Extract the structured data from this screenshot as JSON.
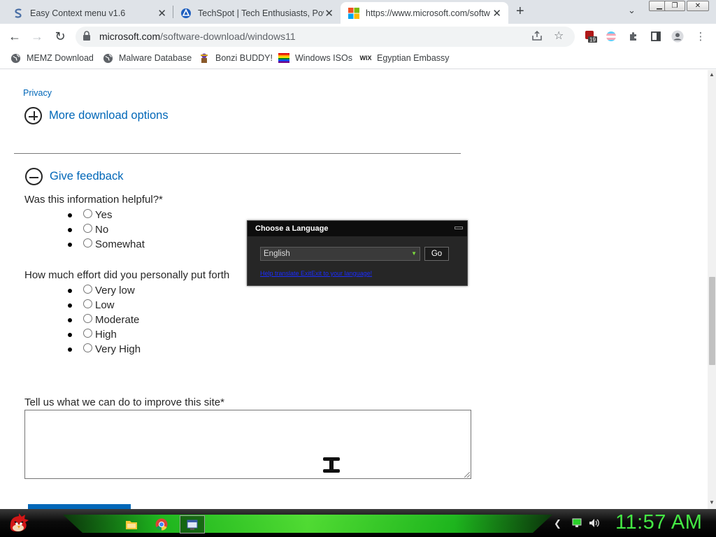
{
  "browser": {
    "tabs": [
      {
        "title": "Easy Context menu v1.6",
        "icon": "s-letter-icon"
      },
      {
        "title": "TechSpot | Tech Enthusiasts, Pow",
        "icon": "techspot-icon"
      },
      {
        "title": "https://www.microsoft.com/softw",
        "icon": "microsoft-logo-icon"
      }
    ],
    "new_tab_symbol": "+",
    "url_host": "microsoft.com",
    "url_path": "/software-download/windows11",
    "extension_badge": "19"
  },
  "bookmarks": [
    {
      "label": "MEMZ Download",
      "icon": "globe-icon"
    },
    {
      "label": "Malware Database",
      "icon": "globe-icon"
    },
    {
      "label": "Bonzi BUDDY!",
      "icon": "bonzi-icon"
    },
    {
      "label": "Windows ISOs",
      "icon": "rainbow-flag-icon"
    },
    {
      "label": "Egyptian Embassy",
      "icon": "wix-icon"
    }
  ],
  "page": {
    "privacy_link": "Privacy",
    "more_download_options": "More download options",
    "give_feedback": "Give feedback",
    "q1": "Was this information helpful?*",
    "q1_options": [
      "Yes",
      "No",
      "Somewhat"
    ],
    "q2": "How much effort did you personally put forth",
    "q2_options": [
      "Very low",
      "Low",
      "Moderate",
      "High",
      "Very High"
    ],
    "q3": "Tell us what we can do to improve this site*"
  },
  "language_popup": {
    "title": "Choose a Language",
    "selected_language": "English",
    "go_label": "Go",
    "help_link": "Help translate ExitExit to your language!"
  },
  "taskbar": {
    "clock": "11:57 AM"
  },
  "colors": {
    "link_blue": "#0067b8",
    "clock_green": "#44e844",
    "taskbar_green": "#21d321"
  }
}
